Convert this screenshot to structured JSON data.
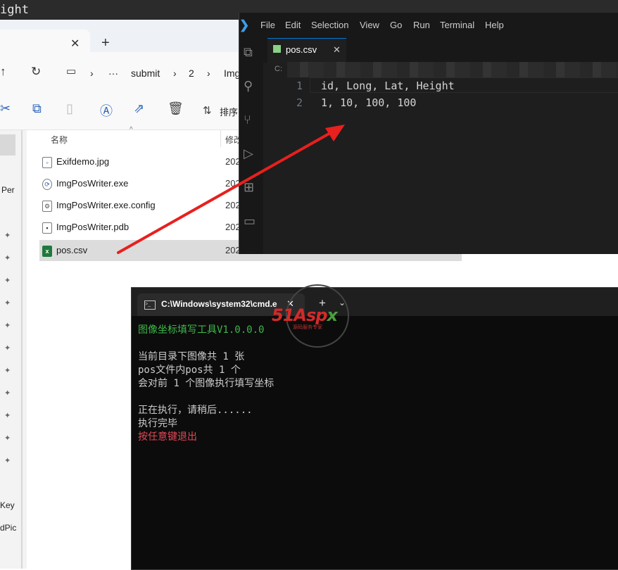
{
  "top_strip": {
    "text": "ight"
  },
  "explorer": {
    "tab_close": "✕",
    "tab_new": "+",
    "breadcrumbs": [
      "submit",
      "2",
      "Img"
    ],
    "more": "···",
    "toolbar_sort": "排序",
    "col_name": "名称",
    "col_modified": "修改",
    "sidebar_texts": [
      "Per",
      "Key",
      "dPic"
    ],
    "files": [
      {
        "name": "Exifdemo.jpg",
        "date": "202",
        "icon": "image-file-icon",
        "ic": "▫"
      },
      {
        "name": "ImgPosWriter.exe",
        "date": "202",
        "icon": "exe-file-icon",
        "ic": "⟳"
      },
      {
        "name": "ImgPosWriter.exe.config",
        "date": "202",
        "icon": "config-file-icon",
        "ic": "⚙"
      },
      {
        "name": "ImgPosWriter.pdb",
        "date": "202",
        "icon": "pdb-file-icon",
        "ic": "▪"
      },
      {
        "name": "pos.csv",
        "date": "202",
        "icon": "csv-file-icon",
        "ic": "x"
      }
    ]
  },
  "vscode": {
    "menu": [
      "File",
      "Edit",
      "Selection",
      "View",
      "Go",
      "Run",
      "Terminal",
      "Help"
    ],
    "tab_label": "pos.csv",
    "tab_close": "✕",
    "breadcrumb": "C:",
    "lines": [
      {
        "num": "1",
        "code": "id, Long, Lat, Height"
      },
      {
        "num": "2",
        "code": "1, 10, 100, 100"
      }
    ]
  },
  "cmd": {
    "title": "C:\\Windows\\system32\\cmd.e",
    "tab_close": "✕",
    "new_tab": "+",
    "dropdown": "⌄",
    "lines": [
      {
        "text": "图像坐标填写工具V1.0.0.0",
        "color": "#3db84a"
      },
      {
        "text": "",
        "color": "#cccccc"
      },
      {
        "text": "当前目录下图像共 1 张",
        "color": "#cccccc"
      },
      {
        "text": "pos文件内pos共 1 个",
        "color": "#cccccc"
      },
      {
        "text": "会对前 1 个图像执行填写坐标",
        "color": "#cccccc"
      },
      {
        "text": "",
        "color": "#cccccc"
      },
      {
        "text": "正在执行，请稍后......",
        "color": "#cccccc"
      },
      {
        "text": "执行完毕",
        "color": "#cccccc"
      },
      {
        "text": "按任意键退出",
        "color": "#e74856"
      }
    ]
  },
  "watermark": {
    "main": "51Asp",
    "accent": "x",
    "sub": "源码服务专家"
  },
  "colors": {
    "arrow": "#e8201e",
    "vscode_bg": "#1e1e1e",
    "cmd_bg": "#0c0c0c"
  }
}
